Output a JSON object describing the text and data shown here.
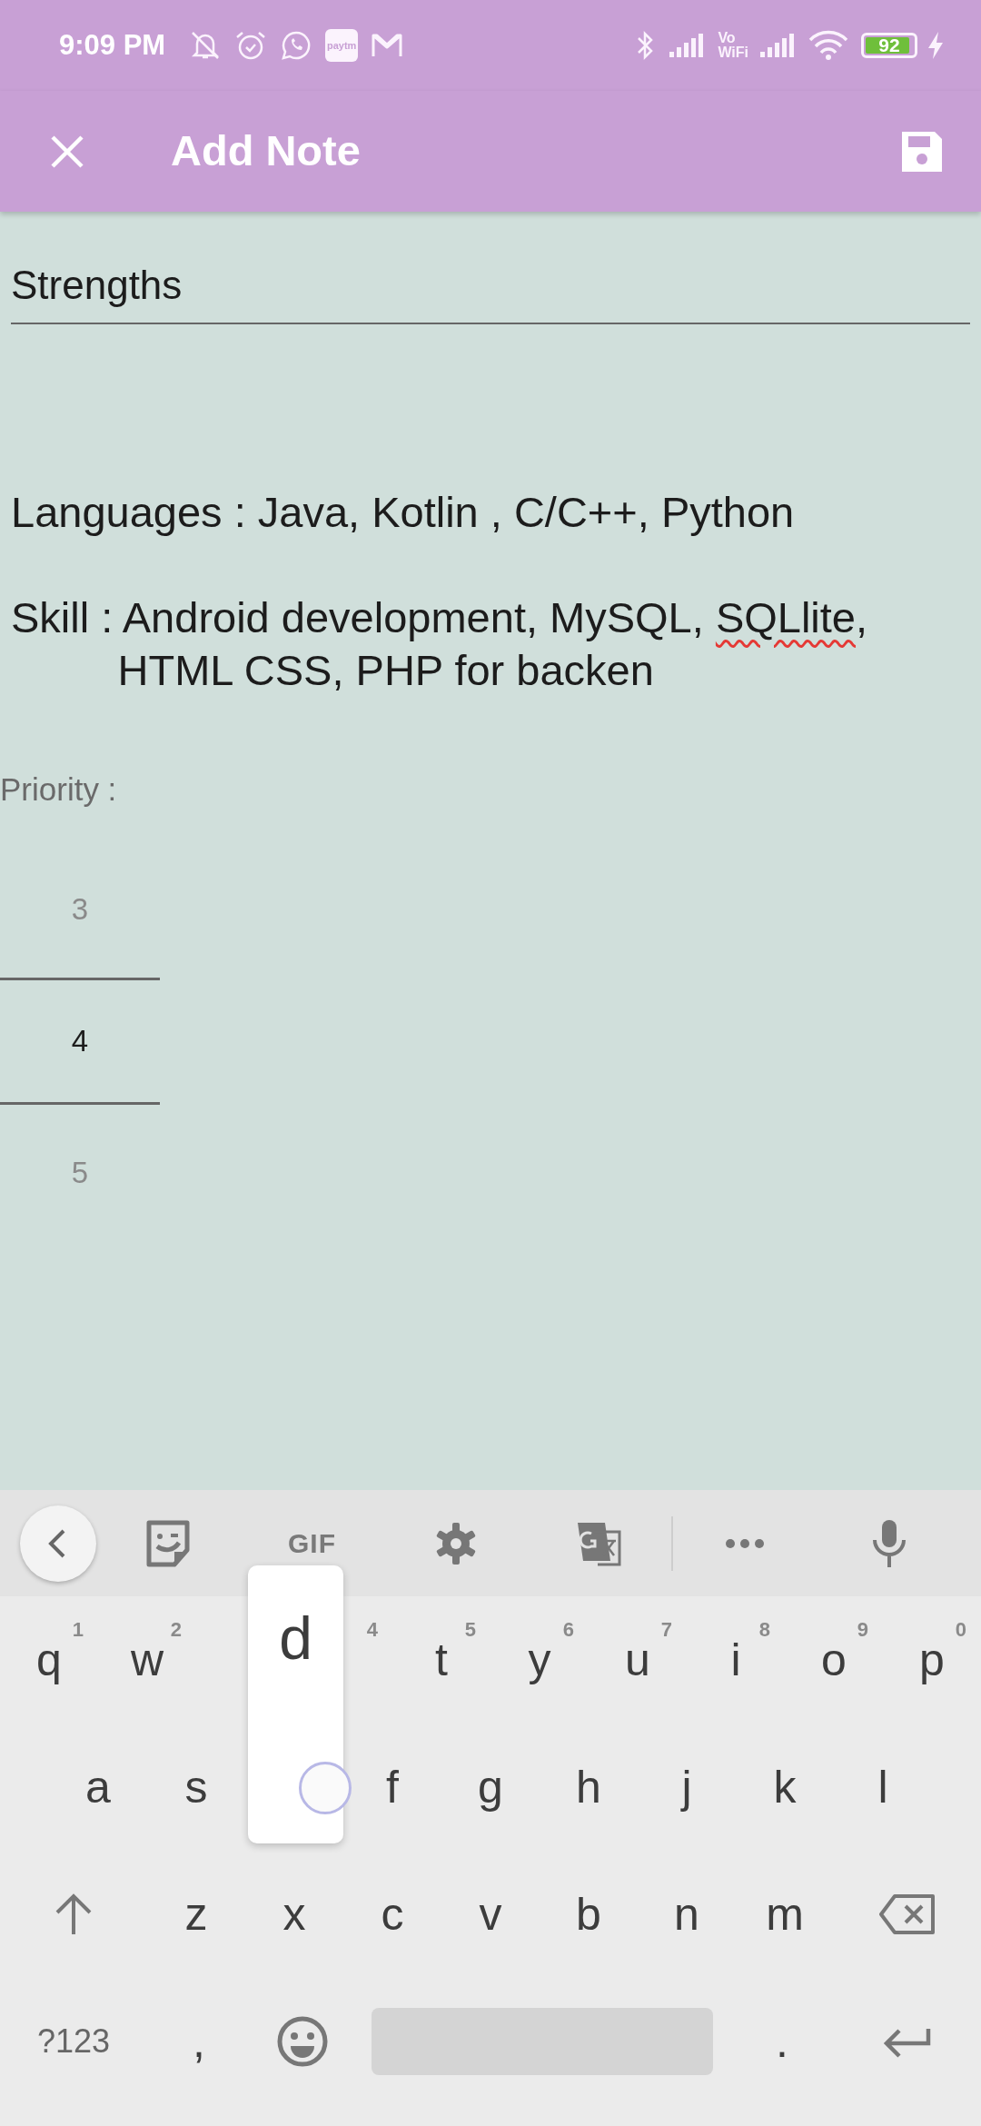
{
  "status_bar": {
    "time": "9:09 PM",
    "app_badge": "paytm",
    "vowifi_top": "Vo",
    "vowifi_bottom": "WiFi",
    "battery": "92"
  },
  "app_bar": {
    "title": "Add Note"
  },
  "note": {
    "title": "Strengths",
    "paragraphs": [
      {
        "lines": [
          [
            {
              "text": "Languages : Java, Kotlin , C/C++, Python"
            }
          ]
        ]
      },
      {
        "lines": [
          [
            {
              "text": "Skill : Android development, MySQL, "
            },
            {
              "text": "SQLlite",
              "misspelled": true
            },
            {
              "text": ","
            }
          ],
          [
            {
              "text": "         HTML CSS, PHP for backen"
            }
          ]
        ]
      }
    ]
  },
  "priority": {
    "label": "Priority :",
    "options": [
      {
        "label": "3",
        "selected": false
      },
      {
        "label": "4",
        "selected": true
      },
      {
        "label": "5",
        "selected": false
      }
    ]
  },
  "keyboard": {
    "toolbar_gif": "GIF",
    "key_popup": "d",
    "rows": [
      {
        "keys": [
          {
            "label": "q",
            "hint": "1"
          },
          {
            "label": "w",
            "hint": "2"
          },
          {
            "kind": "covered"
          },
          {
            "kind": "covered",
            "hint": "4"
          },
          {
            "label": "t",
            "hint": "5"
          },
          {
            "label": "y",
            "hint": "6"
          },
          {
            "label": "u",
            "hint": "7"
          },
          {
            "label": "i",
            "hint": "8"
          },
          {
            "label": "o",
            "hint": "9"
          },
          {
            "label": "p",
            "hint": "0"
          }
        ]
      },
      {
        "keys": [
          {
            "label": "a"
          },
          {
            "label": "s"
          },
          {
            "kind": "covered"
          },
          {
            "label": "f"
          },
          {
            "label": "g"
          },
          {
            "label": "h"
          },
          {
            "label": "j"
          },
          {
            "label": "k"
          },
          {
            "label": "l"
          }
        ]
      },
      {
        "keys": [
          {
            "kind": "shift"
          },
          {
            "label": "z"
          },
          {
            "label": "x"
          },
          {
            "label": "c"
          },
          {
            "label": "v"
          },
          {
            "label": "b"
          },
          {
            "label": "n"
          },
          {
            "label": "m"
          },
          {
            "kind": "backspace"
          }
        ]
      },
      {
        "keys": [
          {
            "kind": "symbols",
            "label": "?123"
          },
          {
            "label": ","
          },
          {
            "kind": "emoji"
          },
          {
            "kind": "space"
          },
          {
            "label": "."
          },
          {
            "kind": "enter"
          }
        ]
      }
    ]
  }
}
